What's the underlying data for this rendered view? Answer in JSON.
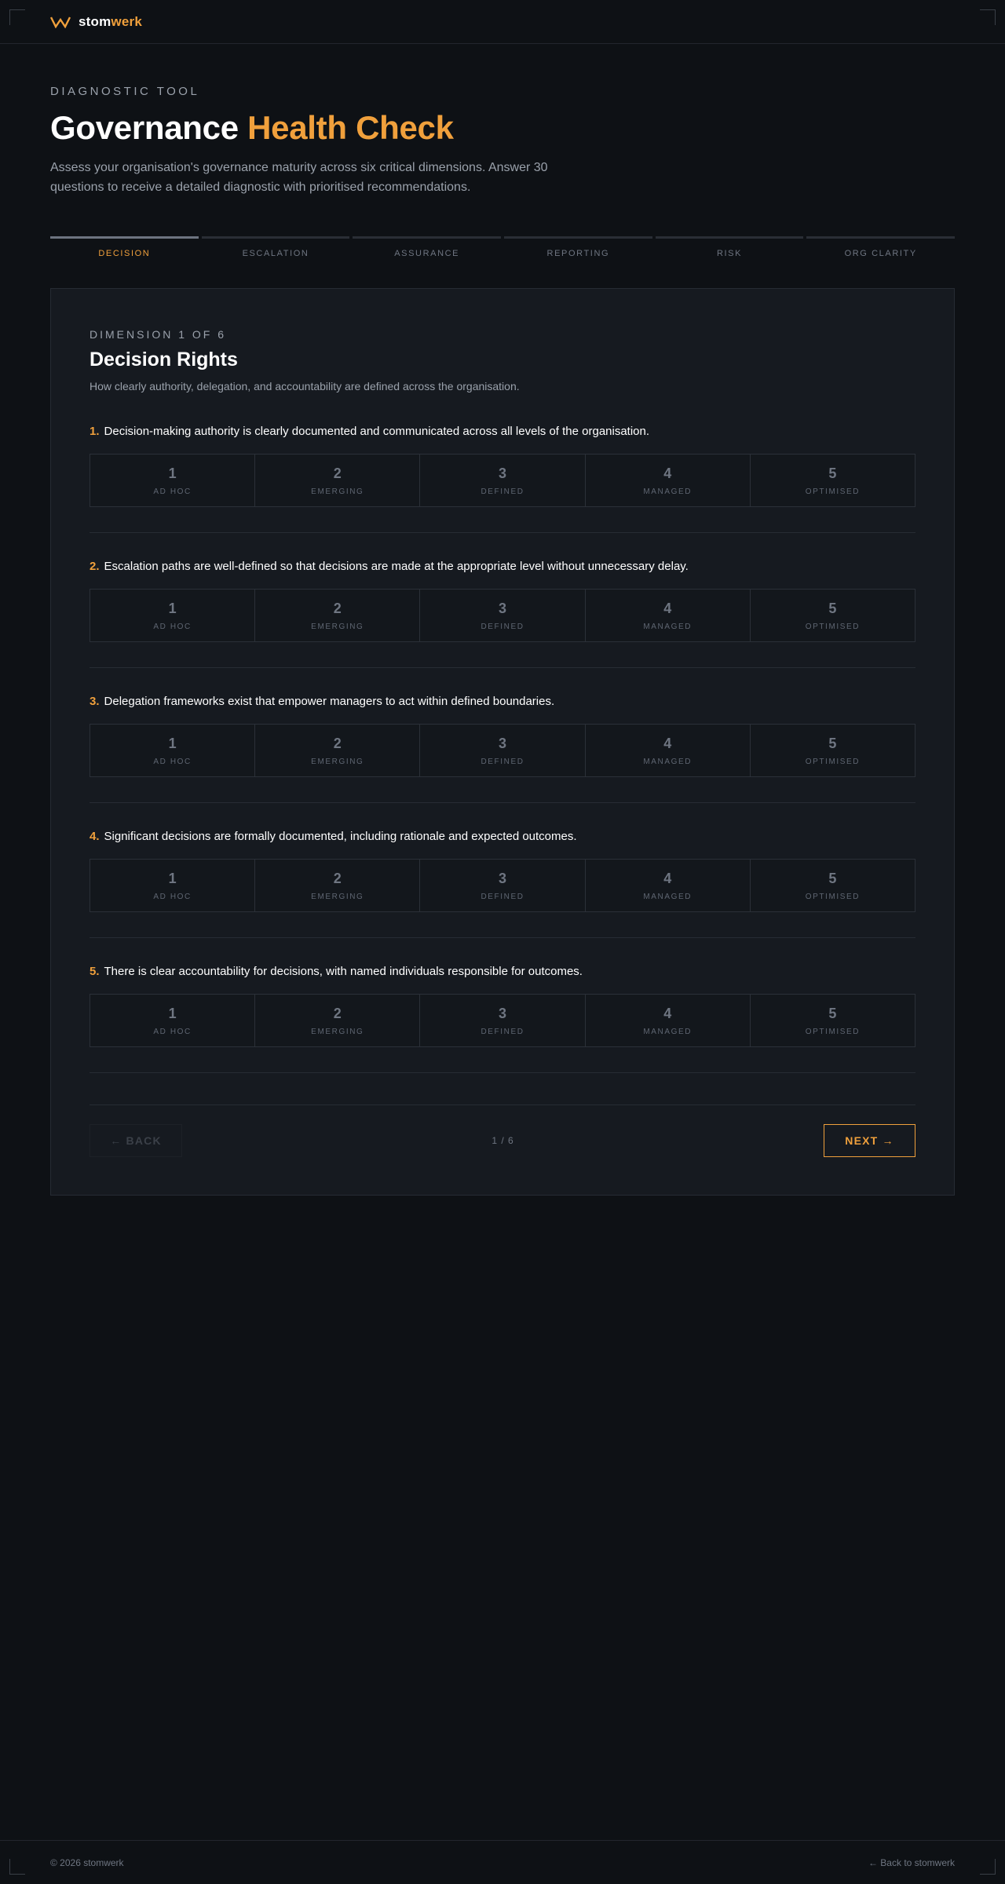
{
  "brand": {
    "name_primary": "stom",
    "name_accent": "werk",
    "accent_color": "#f0a03c",
    "logo_icon": "w-chevron-logo-icon"
  },
  "hero": {
    "eyebrow": "DIAGNOSTIC TOOL",
    "title_primary": "Governance",
    "title_accent": "Health Check",
    "lead": "Assess your organisation's governance maturity across six critical dimensions. Answer 30 questions to receive a detailed diagnostic with prioritised recommendations."
  },
  "steps": [
    {
      "label": "DECISION",
      "active": true
    },
    {
      "label": "ESCALATION",
      "active": false
    },
    {
      "label": "ASSURANCE",
      "active": false
    },
    {
      "label": "REPORTING",
      "active": false
    },
    {
      "label": "RISK",
      "active": false
    },
    {
      "label": "ORG CLARITY",
      "active": false
    }
  ],
  "dimension": {
    "eyebrow": "DIMENSION 1 OF 6",
    "title": "Decision Rights",
    "description": "How clearly authority, delegation, and accountability are defined across the organisation."
  },
  "scale": [
    {
      "value": "1",
      "label": "AD HOC"
    },
    {
      "value": "2",
      "label": "EMERGING"
    },
    {
      "value": "3",
      "label": "DEFINED"
    },
    {
      "value": "4",
      "label": "MANAGED"
    },
    {
      "value": "5",
      "label": "OPTIMISED"
    }
  ],
  "questions": [
    {
      "number": "1.",
      "text": "Decision-making authority is clearly documented and communicated across all levels of the organisation."
    },
    {
      "number": "2.",
      "text": "Escalation paths are well-defined so that decisions are made at the appropriate level without unnecessary delay."
    },
    {
      "number": "3.",
      "text": "Delegation frameworks exist that empower managers to act within defined boundaries."
    },
    {
      "number": "4.",
      "text": "Significant decisions are formally documented, including rationale and expected outcomes."
    },
    {
      "number": "5.",
      "text": "There is clear accountability for decisions, with named individuals responsible for outcomes."
    }
  ],
  "nav": {
    "back_label": "← BACK",
    "next_label": "NEXT →",
    "pager": "1 / 6"
  },
  "footer": {
    "copyright": "© 2026 stomwerk",
    "back_link": "← Back to stomwerk"
  }
}
